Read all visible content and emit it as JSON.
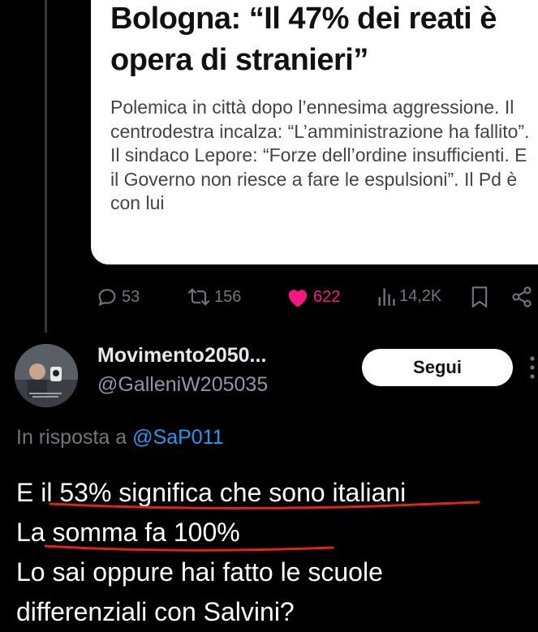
{
  "article": {
    "title": "Bologna: “Il 47% dei reati è opera di stranieri”",
    "summary": "Polemica in città dopo l’ennesima aggressione. Il centrodestra incalza: “L’amministrazione ha fallito”. Il sindaco Lepore: “Forze dell’ordine insufficienti. E il Governo non riesce a fare le espulsioni”. Il Pd è con lui"
  },
  "actions": {
    "replies": "53",
    "retweets": "156",
    "likes": "622",
    "views": "14,2K",
    "like_color": "#f91880"
  },
  "reply_tweet": {
    "display_name": "Movimento2050...",
    "handle": "@GalleniW205035",
    "follow_label": "Segui",
    "reply_prefix": "In risposta a",
    "reply_to": "@SaP011",
    "lines": [
      "E il 53% significa che sono italiani",
      "La somma fa 100%",
      "Lo sai oppure hai fatto le scuole",
      "differenziali con Salvini?"
    ],
    "underline_color": "#e0241b"
  },
  "icons": {
    "reply": "reply-icon",
    "retweet": "retweet-icon",
    "like": "heart-icon",
    "views": "views-icon",
    "bookmark": "bookmark-icon",
    "share": "share-icon",
    "more": "more-vertical-icon"
  }
}
